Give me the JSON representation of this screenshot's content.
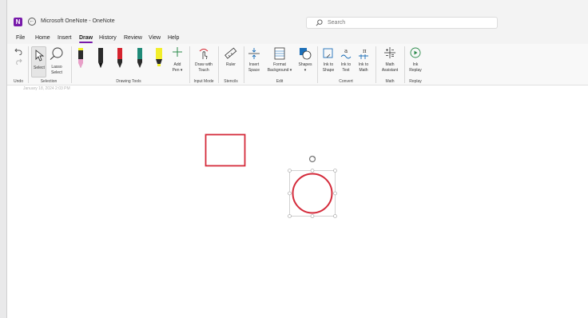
{
  "window": {
    "title": "Microsoft OneNote - OneNote",
    "logo_letter": "N",
    "back_glyph": "←"
  },
  "search": {
    "placeholder": "Search"
  },
  "menu": {
    "tabs": [
      {
        "label": "File"
      },
      {
        "label": "Home"
      },
      {
        "label": "Insert"
      },
      {
        "label": "Draw",
        "active": true
      },
      {
        "label": "History"
      },
      {
        "label": "Review"
      },
      {
        "label": "View"
      },
      {
        "label": "Help"
      }
    ]
  },
  "ribbon": {
    "groups": {
      "undo": "Undo",
      "selection": "Selection",
      "drawing_tools": "Drawing Tools",
      "input_mode": "Input Mode",
      "stencils": "Stencils",
      "edit": "Edit",
      "convert": "Convert",
      "math": "Math",
      "replay": "Replay"
    },
    "buttons": {
      "select": "Select",
      "lasso_1": "Lasso",
      "lasso_2": "Select",
      "add_pen_1": "Add",
      "add_pen_2": "Pen ▾",
      "draw_touch_1": "Draw with",
      "draw_touch_2": "Touch",
      "ruler": "Ruler",
      "insert_space_1": "Insert",
      "insert_space_2": "Space",
      "format_bg_1": "Format",
      "format_bg_2": "Background ▾",
      "shapes": "Shapes",
      "shapes_caret": "▾",
      "ink_shape_1": "Ink to",
      "ink_shape_2": "Shape",
      "ink_text_1": "Ink to",
      "ink_text_2": "Text",
      "ink_math_1": "Ink to",
      "ink_math_2": "Math",
      "math_asst_1": "Math",
      "math_asst_2": "Assistant",
      "ink_replay_1": "Ink",
      "ink_replay_2": "Replay"
    },
    "pens": [
      {
        "name": "pen-pink",
        "tip": "#e8a0c8"
      },
      {
        "name": "pen-black",
        "tip": "#111111"
      },
      {
        "name": "pen-red",
        "tip": "#d6232e"
      },
      {
        "name": "pen-teal",
        "tip": "#1f8a78"
      },
      {
        "name": "highlighter-yellow",
        "tip": "#f2ee2a"
      }
    ]
  },
  "canvas": {
    "date": "January 18, 2024     2:03 PM",
    "ink_color": "#d42a3a"
  }
}
